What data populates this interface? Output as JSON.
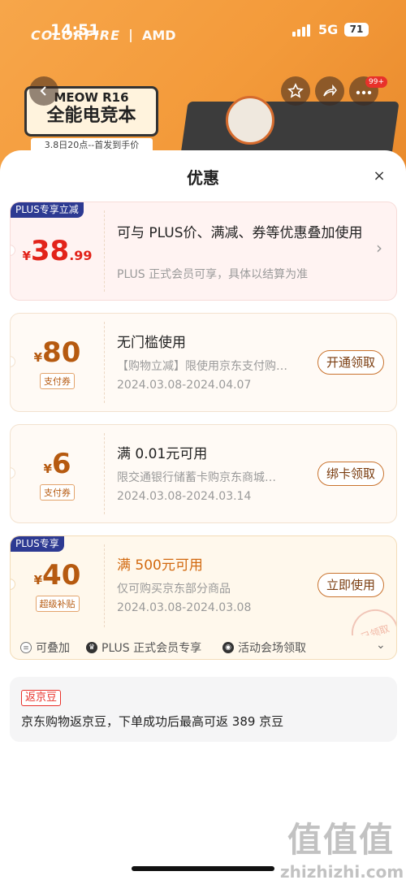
{
  "status_bar": {
    "time": "14:51",
    "network": "5G",
    "battery": "71"
  },
  "banner": {
    "brand": "COLORFIRE",
    "brand2": "AMD",
    "product_line1": "MEOW R16",
    "product_line2": "全能电竞本",
    "subtitle": "3.8日20点--首发到手价",
    "notification_badge": "99+"
  },
  "sheet": {
    "title": "优惠",
    "close_icon": "×"
  },
  "coupons": [
    {
      "tag": "PLUS专享立减",
      "currency": "¥",
      "amount": "38",
      "decimal": ".99",
      "title": "可与 PLUS价、满减、券等优惠叠加使用",
      "desc": "PLUS 正式会员可享，具体以结算为准",
      "chevron": "›"
    },
    {
      "currency": "¥",
      "amount": "80",
      "type": "支付券",
      "title": "无门槛使用",
      "desc": "【购物立减】限使用京东支付购…",
      "date": "2024.03.08-2024.04.07",
      "button": "开通领取"
    },
    {
      "currency": "¥",
      "amount": "6",
      "type": "支付券",
      "title": "满 0.01元可用",
      "desc": "限交通银行储蓄卡购京东商城…",
      "date": "2024.03.08-2024.03.14",
      "button": "绑卡领取"
    },
    {
      "tag": "PLUS专享",
      "currency": "¥",
      "amount": "40",
      "type": "超级补贴",
      "title": "满 500元可用",
      "desc": "仅可购买京东部分商品",
      "date": "2024.03.08-2024.03.08",
      "button": "立即使用",
      "stamp": "已领取"
    }
  ],
  "benefits": [
    "可叠加",
    "PLUS 正式会员专享",
    "活动会场领取"
  ],
  "jingdou": {
    "tag": "返京豆",
    "text": "京东购物返京豆，下单成功后最高可返 389 京豆"
  },
  "watermark": {
    "glyph": "值值值",
    "text": "zhizhizhi.com"
  }
}
